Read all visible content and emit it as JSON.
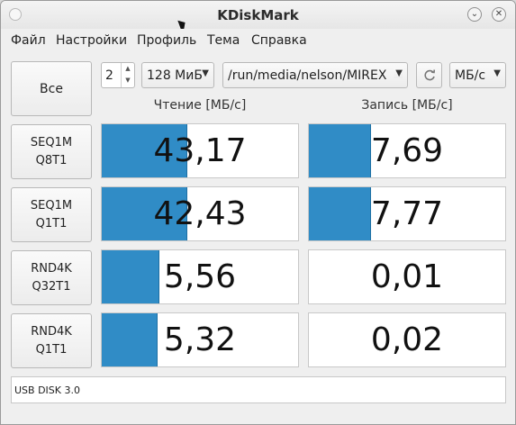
{
  "window": {
    "title": "KDiskMark"
  },
  "menu": [
    "Файл",
    "Настройки",
    "Профиль",
    "Тема",
    "Справка"
  ],
  "toolbar": {
    "all_label": "Все",
    "runs": "2",
    "size": "128 МиБ",
    "path": "/run/media/nelson/MIREX",
    "units": "МБ/с"
  },
  "columns": {
    "read": "Чтение [МБ/с]",
    "write": "Запись [МБ/с]"
  },
  "tests": [
    {
      "line1": "SEQ1M",
      "line2": "Q8T1",
      "read": "43,17",
      "write": "7,69",
      "read_fill": 0.43,
      "write_fill": 0.31
    },
    {
      "line1": "SEQ1M",
      "line2": "Q1T1",
      "read": "42,43",
      "write": "7,77",
      "read_fill": 0.43,
      "write_fill": 0.31
    },
    {
      "line1": "RND4K",
      "line2": "Q32T1",
      "read": "5,56",
      "write": "0,01",
      "read_fill": 0.29,
      "write_fill": 0
    },
    {
      "line1": "RND4K",
      "line2": "Q1T1",
      "read": "5,32",
      "write": "0,02",
      "read_fill": 0.28,
      "write_fill": 0
    }
  ],
  "status": "USB DISK 3.0",
  "colors": {
    "bar": "#308cc6"
  }
}
